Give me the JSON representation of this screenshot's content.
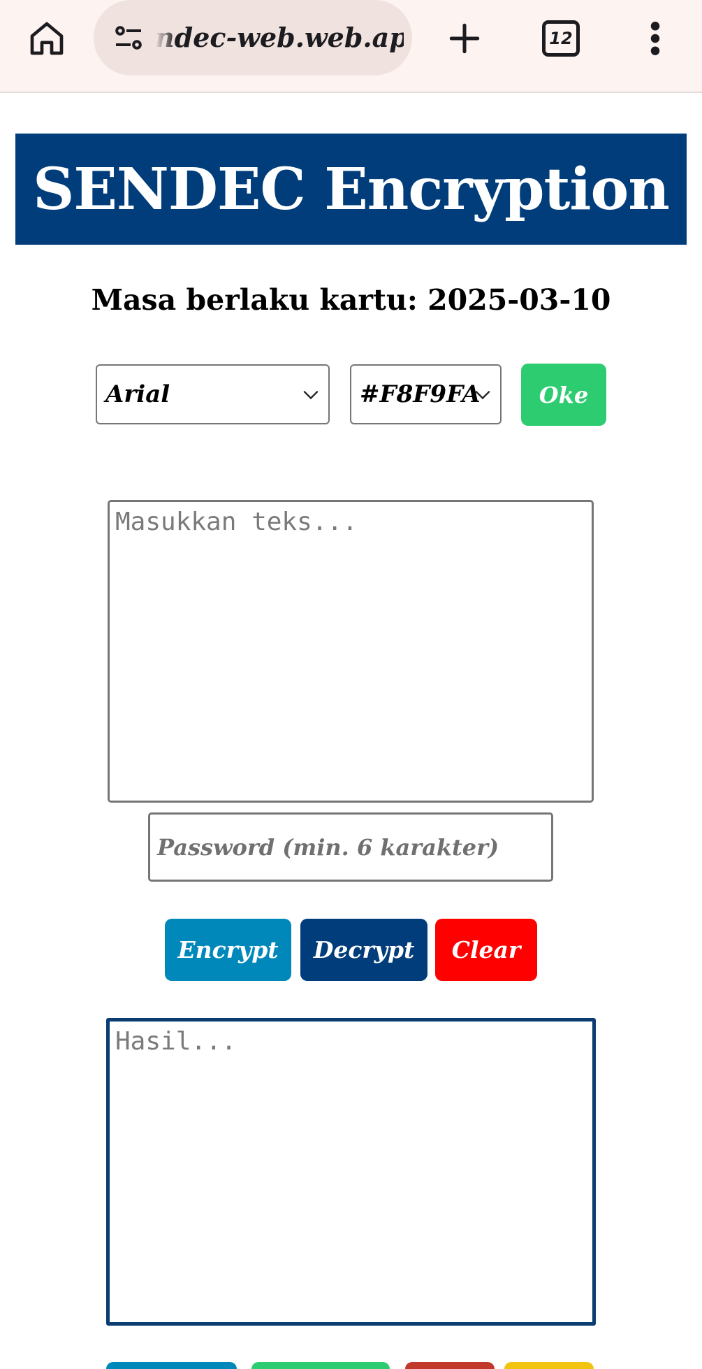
{
  "browser": {
    "url": "ndec-web.web.app",
    "tab_count": "12",
    "icons": {
      "home": "home-icon",
      "site_settings": "tune-icon",
      "new_tab": "plus-icon",
      "menu": "more-vertical-icon"
    }
  },
  "page": {
    "title": "SENDEC Encryption",
    "validity_text": "Masa berlaku kartu: 2025-03-10",
    "font_select": {
      "value": "Arial"
    },
    "color_select": {
      "value": "#F8F9FA"
    },
    "oke_label": "Oke",
    "input": {
      "placeholder": "Masukkan teks...",
      "value": ""
    },
    "password": {
      "placeholder": "Password (min. 6 karakter)",
      "value": ""
    },
    "buttons": {
      "encrypt": "Encrypt",
      "decrypt": "Decrypt",
      "clear": "Clear"
    },
    "result": {
      "placeholder": "Hasil...",
      "value": ""
    }
  },
  "colors": {
    "banner": "#003d7a",
    "oke": "#2ecc71",
    "encrypt": "#0088bb",
    "decrypt": "#003d7a",
    "clear": "#ff0000",
    "result_border": "#0b3d72"
  }
}
